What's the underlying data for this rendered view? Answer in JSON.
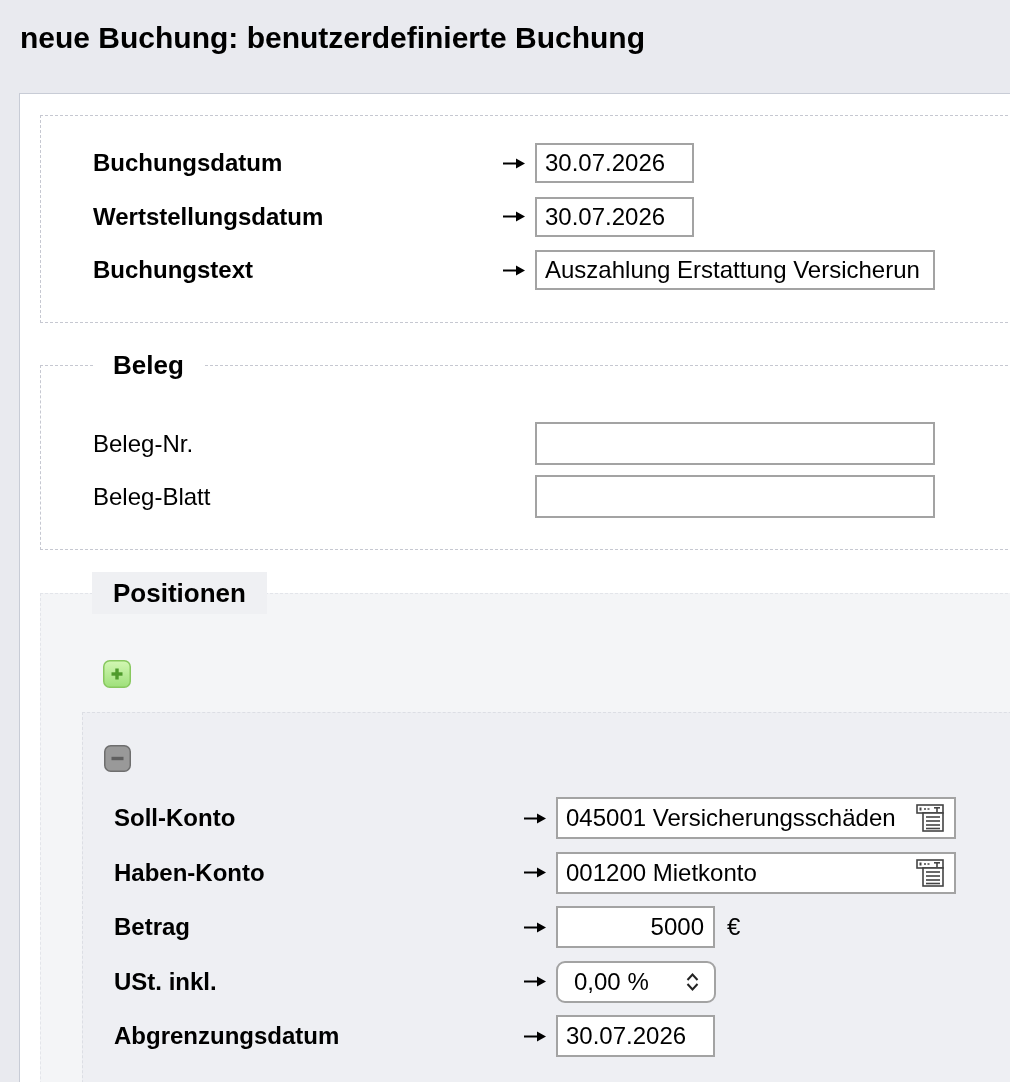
{
  "title": "neue Buchung: benutzerdefinierte Buchung",
  "booking": {
    "fields": [
      {
        "label": "Buchungsdatum",
        "kind": "date",
        "required": true,
        "value": "30.07.2026"
      },
      {
        "label": "Wertstellungsdatum",
        "kind": "date",
        "required": true,
        "value": "30.07.2026"
      },
      {
        "label": "Buchungstext",
        "kind": "text",
        "required": true,
        "value": "Auszahlung Erstattung Versicherun"
      }
    ]
  },
  "receipt": {
    "legend": "Beleg",
    "fields": [
      {
        "label": "Beleg-Nr.",
        "kind": "text",
        "required": false
      },
      {
        "label": "Beleg-Blatt",
        "kind": "text",
        "required": false
      }
    ]
  },
  "positions": {
    "legend": "Positionen",
    "items": [
      {
        "fields": [
          {
            "label": "Soll-Konto",
            "kind": "account",
            "required": true,
            "value": "045001 Versicherungsschäden"
          },
          {
            "label": "Haben-Konto",
            "kind": "account",
            "required": true,
            "value": "001200 Mietkonto"
          },
          {
            "label": "Betrag",
            "kind": "amount",
            "required": true,
            "value": "5000",
            "unit": "€"
          },
          {
            "label": "USt. inkl.",
            "kind": "select",
            "required": true,
            "value": "0,00 %"
          },
          {
            "label": "Abgrenzungsdatum",
            "kind": "date",
            "required": true,
            "value": "30.07.2026"
          }
        ]
      }
    ]
  }
}
